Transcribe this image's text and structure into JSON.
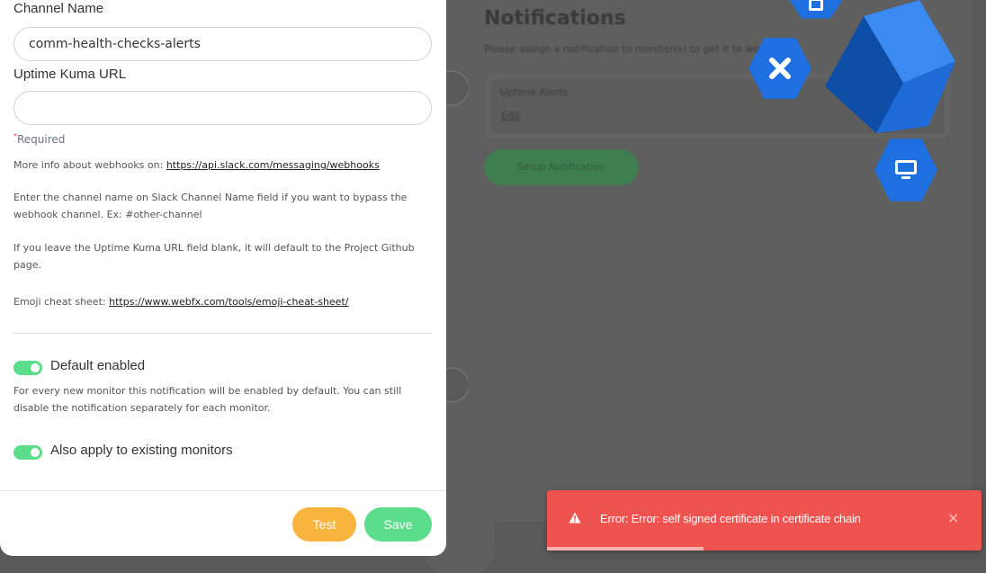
{
  "background": {
    "title": "Notifications",
    "description": "Please assign a notification to monitor(s) to get it to work",
    "notification_name": "Uptime Alerts",
    "edit_label": "Edit",
    "setup_button": "Setup Notification"
  },
  "modal": {
    "channel_name_label": "Channel Name",
    "channel_name_value": "comm-health-checks-alerts",
    "uptime_kuma_url_label": "Uptime Kuma URL",
    "uptime_kuma_url_value": "",
    "required_text": "Required",
    "webhook_info_prefix": "More info about webhooks on: ",
    "webhook_info_link": "https://api.slack.com/messaging/webhooks",
    "channel_hint": "Enter the channel name on Slack Channel Name field if you want to bypass the webhook channel. Ex: #other-channel",
    "url_hint": "If you leave the Uptime Kuma URL field blank, it will default to the Project Github page.",
    "emoji_prefix": "Emoji cheat sheet: ",
    "emoji_link": "https://www.webfx.com/tools/emoji-cheat-sheet/",
    "default_enabled_label": "Default enabled",
    "default_enabled_help": "For every new monitor this notification will be enabled by default. You can still disable the notification separately for each monitor.",
    "apply_existing_label": "Also apply to existing monitors",
    "test_button": "Test",
    "save_button": "Save"
  },
  "toast": {
    "message": "Error: Error: self signed certificate in certificate chain",
    "close": "×",
    "progress": 0.36
  },
  "colors": {
    "toggle_on": "#5cdd8b",
    "test_button": "#f8b43c",
    "save_button": "#5cdd8b",
    "toast_error": "#ef5350",
    "hex_icon": "#1e6fe0"
  },
  "icons": [
    "close-icon",
    "monitor-icon",
    "cube-icon",
    "warning-icon"
  ]
}
